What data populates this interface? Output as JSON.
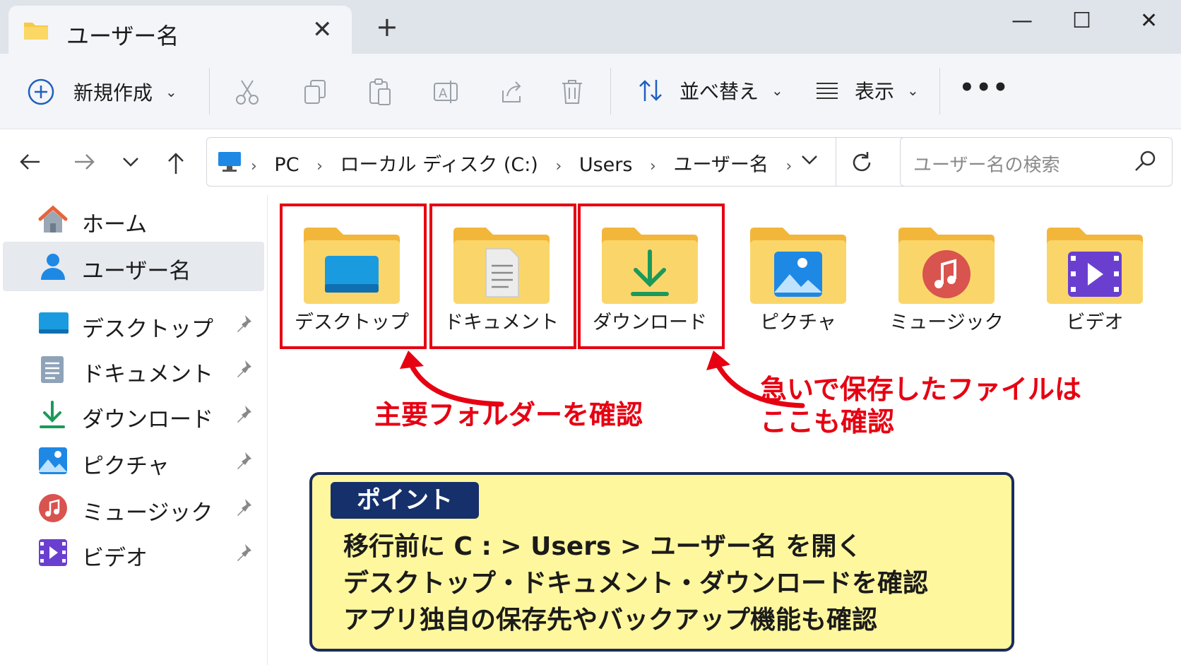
{
  "window": {
    "tab_title": "ユーザー名",
    "tab_close": "✕",
    "new_tab": "+",
    "minimize": "—",
    "maximize": "☐",
    "close": "✕"
  },
  "toolbar": {
    "new_label": "新規作成",
    "sort_label": "並べ替え",
    "view_label": "表示",
    "more": "•••",
    "chevron": "⌄"
  },
  "address": {
    "crumbs": [
      "PC",
      "ローカル ディスク (C:)",
      "Users",
      "ユーザー名"
    ],
    "sep": "›"
  },
  "search": {
    "placeholder": "ユーザー名の検索"
  },
  "sidebar": {
    "items": [
      {
        "label": "ホーム"
      },
      {
        "label": "ユーザー名"
      },
      {
        "label": "デスクトップ"
      },
      {
        "label": "ドキュメント"
      },
      {
        "label": "ダウンロード"
      },
      {
        "label": "ピクチャ"
      },
      {
        "label": "ミュージック"
      },
      {
        "label": "ビデオ"
      }
    ]
  },
  "folders": [
    {
      "label": "デスクトップ"
    },
    {
      "label": "ドキュメント"
    },
    {
      "label": "ダウンロード"
    },
    {
      "label": "ピクチャ"
    },
    {
      "label": "ミュージック"
    },
    {
      "label": "ビデオ"
    }
  ],
  "annotations": {
    "main_folders": "主要フォルダーを確認",
    "download_note_1": "急いで保存したファイルは",
    "download_note_2": "ここも確認"
  },
  "point": {
    "badge": "ポイント",
    "lines": [
      "移行前に C : > Users > ユーザー名 を開く",
      "デスクトップ・ドキュメント・ダウンロードを確認",
      "アプリ独自の保存先やバックアップ機能も確認"
    ]
  },
  "colors": {
    "accent": "#e60012",
    "folder": "#f7c948",
    "point_bg": "#fff79d",
    "point_border": "#1a2c5b"
  }
}
